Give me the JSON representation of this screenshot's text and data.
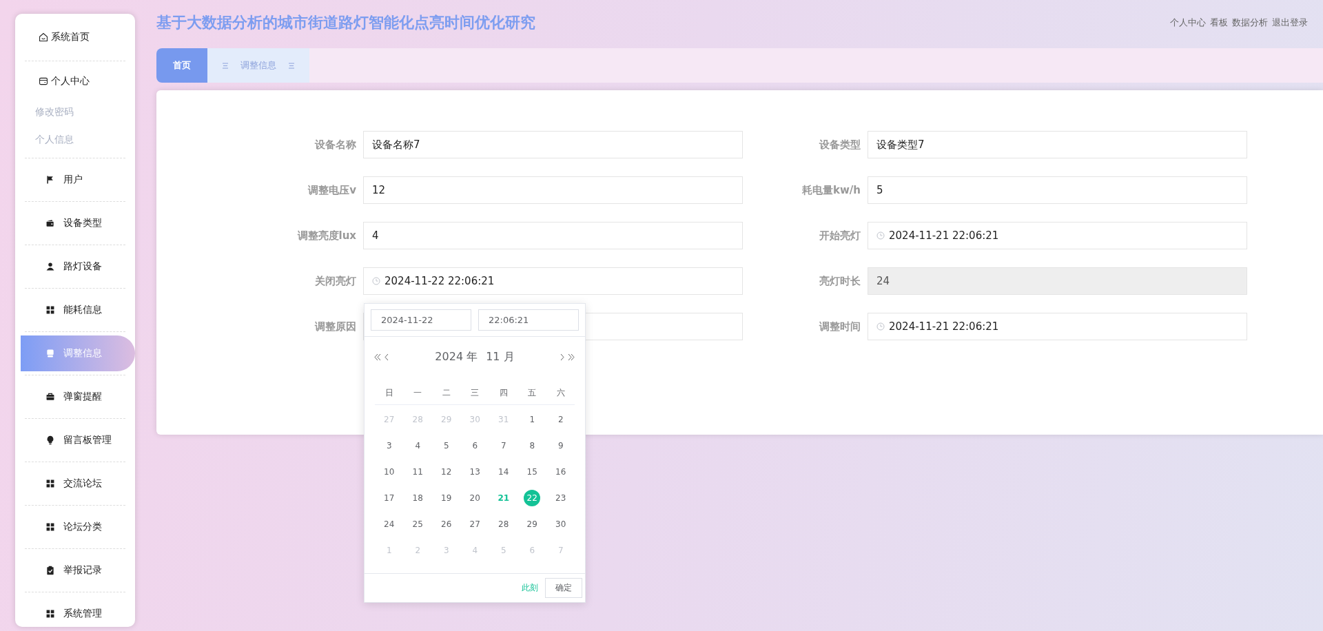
{
  "app_title": "基于大数据分析的城市街道路灯智能化点亮时间优化研究",
  "top_links": [
    "个人中心",
    "看板",
    "数据分析",
    "退出登录"
  ],
  "sidebar": {
    "items": [
      {
        "kind": "top",
        "label": "系统首页",
        "selected": false
      },
      {
        "kind": "top",
        "label": "个人中心",
        "selected": false,
        "children": [
          {
            "label": "修改密码",
            "selected": false
          },
          {
            "label": "个人信息",
            "selected": false
          }
        ]
      },
      {
        "kind": "module",
        "label": "用户",
        "selected": false
      },
      {
        "kind": "module",
        "label": "设备类型",
        "selected": false
      },
      {
        "kind": "module",
        "label": "路灯设备",
        "selected": false
      },
      {
        "kind": "module",
        "label": "能耗信息",
        "selected": false
      },
      {
        "kind": "module",
        "label": "调整信息",
        "selected": true
      },
      {
        "kind": "module",
        "label": "弹窗提醒",
        "selected": false
      },
      {
        "kind": "module",
        "label": "留言板管理",
        "selected": false
      },
      {
        "kind": "module",
        "label": "交流论坛",
        "selected": false
      },
      {
        "kind": "module",
        "label": "论坛分类",
        "selected": false
      },
      {
        "kind": "module",
        "label": "举报记录",
        "selected": false
      },
      {
        "kind": "module",
        "label": "系统管理",
        "selected": false
      }
    ]
  },
  "tabs": [
    {
      "label": "首页",
      "selected": true
    },
    {
      "label": "调整信息",
      "selected": false
    }
  ],
  "form": {
    "fields": [
      {
        "label": "设备名称",
        "kind": "text",
        "value": "设备名称7",
        "disabled": false
      },
      {
        "label": "设备类型",
        "kind": "text",
        "value": "设备类型7",
        "disabled": false
      },
      {
        "label": "调整电压v",
        "kind": "text",
        "value": "12",
        "disabled": false
      },
      {
        "label": "耗电量kw/h",
        "kind": "text",
        "value": "5",
        "disabled": false
      },
      {
        "label": "调整亮度lux",
        "kind": "text",
        "value": "4",
        "disabled": false
      },
      {
        "label": "开始亮灯",
        "kind": "datetime",
        "value": "2024-11-21 22:06:21",
        "disabled": false
      },
      {
        "label": "关闭亮灯",
        "kind": "datetime",
        "value": "2024-11-22 22:06:21",
        "disabled": false
      },
      {
        "label": "亮灯时长",
        "kind": "text",
        "value": "24",
        "disabled": true
      },
      {
        "label": "调整原因",
        "kind": "text",
        "disabled": false
      },
      {
        "label": "调整时间",
        "kind": "datetime",
        "value": "2024-11-21 22:06:21",
        "disabled": false
      }
    ]
  },
  "date_picker": {
    "date_input": "2024-11-22",
    "time_input": "22:06:21",
    "year": "2024 年",
    "month": "11 月",
    "weekdays": [
      "日",
      "一",
      "二",
      "三",
      "四",
      "五",
      "六"
    ],
    "days": [
      {
        "label": "27",
        "kind": "other",
        "selected": false
      },
      {
        "label": "28",
        "kind": "other",
        "selected": false
      },
      {
        "label": "29",
        "kind": "other",
        "selected": false
      },
      {
        "label": "30",
        "kind": "other",
        "selected": false
      },
      {
        "label": "31",
        "kind": "other",
        "selected": false
      },
      {
        "label": "1",
        "kind": "day",
        "selected": false
      },
      {
        "label": "2",
        "kind": "day",
        "selected": false
      },
      {
        "label": "3",
        "kind": "day",
        "selected": false
      },
      {
        "label": "4",
        "kind": "day",
        "selected": false
      },
      {
        "label": "5",
        "kind": "day",
        "selected": false
      },
      {
        "label": "6",
        "kind": "day",
        "selected": false
      },
      {
        "label": "7",
        "kind": "day",
        "selected": false
      },
      {
        "label": "8",
        "kind": "day",
        "selected": false
      },
      {
        "label": "9",
        "kind": "day",
        "selected": false
      },
      {
        "label": "10",
        "kind": "day",
        "selected": false
      },
      {
        "label": "11",
        "kind": "day",
        "selected": false
      },
      {
        "label": "12",
        "kind": "day",
        "selected": false
      },
      {
        "label": "13",
        "kind": "day",
        "selected": false
      },
      {
        "label": "14",
        "kind": "day",
        "selected": false
      },
      {
        "label": "15",
        "kind": "day",
        "selected": false
      },
      {
        "label": "16",
        "kind": "day",
        "selected": false
      },
      {
        "label": "17",
        "kind": "day",
        "selected": false
      },
      {
        "label": "18",
        "kind": "day",
        "selected": false
      },
      {
        "label": "19",
        "kind": "day",
        "selected": false
      },
      {
        "label": "20",
        "kind": "day",
        "selected": false
      },
      {
        "label": "21",
        "kind": "today",
        "selected": false
      },
      {
        "label": "22",
        "kind": "day",
        "selected": true
      },
      {
        "label": "23",
        "kind": "day",
        "selected": false
      },
      {
        "label": "24",
        "kind": "day",
        "selected": false
      },
      {
        "label": "25",
        "kind": "day",
        "selected": false
      },
      {
        "label": "26",
        "kind": "day",
        "selected": false
      },
      {
        "label": "27",
        "kind": "day",
        "selected": false
      },
      {
        "label": "28",
        "kind": "day",
        "selected": false
      },
      {
        "label": "29",
        "kind": "day",
        "selected": false
      },
      {
        "label": "30",
        "kind": "day",
        "selected": false
      },
      {
        "label": "1",
        "kind": "other",
        "selected": false
      },
      {
        "label": "2",
        "kind": "other",
        "selected": false
      },
      {
        "label": "3",
        "kind": "other",
        "selected": false
      },
      {
        "label": "4",
        "kind": "other",
        "selected": false
      },
      {
        "label": "5",
        "kind": "other",
        "selected": false
      },
      {
        "label": "6",
        "kind": "other",
        "selected": false
      },
      {
        "label": "7",
        "kind": "other",
        "selected": false
      }
    ],
    "now_link": "此刻",
    "confirm_button": "确定"
  }
}
